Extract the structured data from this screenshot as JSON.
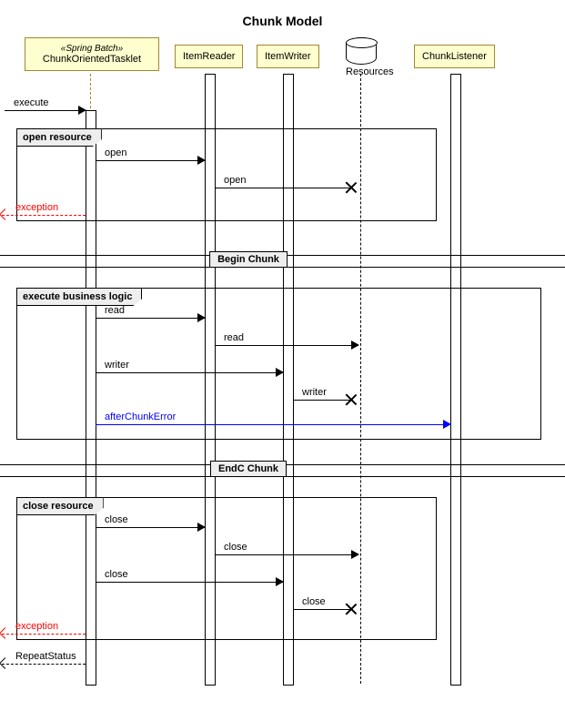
{
  "title": "Chunk Model",
  "participants": {
    "tasklet": {
      "stereotype": "«Spring Batch»",
      "name": "ChunkOrientedTasklet"
    },
    "reader": {
      "name": "ItemReader"
    },
    "writer": {
      "name": "ItemWriter"
    },
    "resources": {
      "name": "Resources"
    },
    "listener": {
      "name": "ChunkListener"
    }
  },
  "frames": {
    "open": "open resource",
    "logic": "execute business logic",
    "close": "close resource"
  },
  "dividers": {
    "begin": "Begin Chunk",
    "end": "EndC Chunk"
  },
  "messages": {
    "execute": "execute",
    "open1": "open",
    "open2": "open",
    "exception1": "exception",
    "read1": "read",
    "read2": "read",
    "writer1": "writer",
    "writer2": "writer",
    "afterChunkError": "afterChunkError",
    "close1": "close",
    "close2": "close",
    "close3": "close",
    "close4": "close",
    "exception2": "exception",
    "repeatStatus": "RepeatStatus"
  }
}
